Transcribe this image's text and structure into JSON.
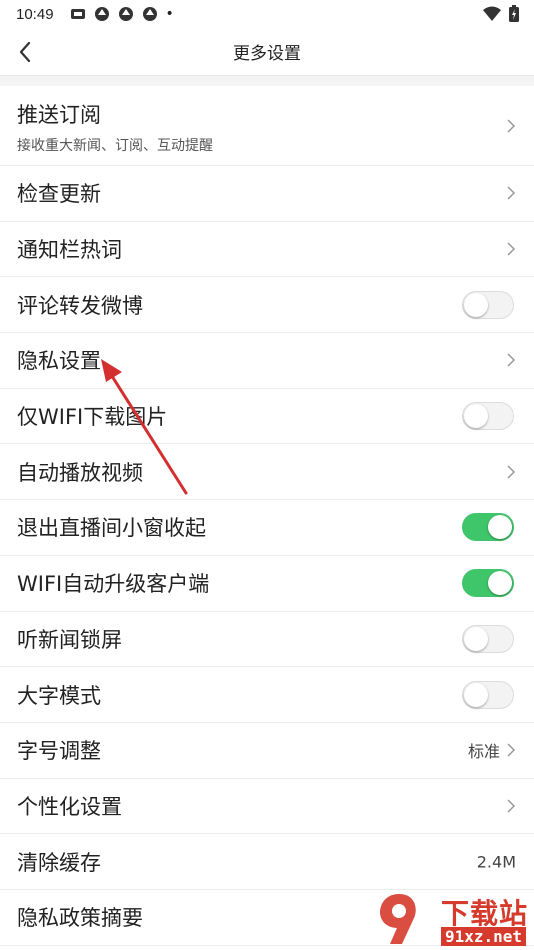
{
  "statusbar": {
    "time": "10:49",
    "dot": "•"
  },
  "navbar": {
    "title": "更多设置"
  },
  "settings": [
    {
      "label": "推送订阅",
      "sub": "接收重大新闻、订阅、互动提醒",
      "control": "chevron"
    },
    {
      "label": "检查更新",
      "control": "chevron"
    },
    {
      "label": "通知栏热词",
      "control": "chevron"
    },
    {
      "label": "评论转发微博",
      "control": "toggle",
      "on": false
    },
    {
      "label": "隐私设置",
      "control": "chevron"
    },
    {
      "label": "仅WIFI下载图片",
      "control": "toggle",
      "on": false
    },
    {
      "label": "自动播放视频",
      "control": "chevron"
    },
    {
      "label": "退出直播间小窗收起",
      "control": "toggle",
      "on": true
    },
    {
      "label": "WIFI自动升级客户端",
      "control": "toggle",
      "on": true
    },
    {
      "label": "听新闻锁屏",
      "control": "toggle",
      "on": false
    },
    {
      "label": "大字模式",
      "control": "toggle",
      "on": false
    },
    {
      "label": "字号调整",
      "control": "value-chevron",
      "value": "标准"
    },
    {
      "label": "个性化设置",
      "control": "chevron"
    },
    {
      "label": "清除缓存",
      "control": "value",
      "value": "2.4M"
    },
    {
      "label": "隐私政策摘要",
      "control": "none"
    }
  ],
  "watermark": {
    "text": "下载站",
    "sub": "91xz.net",
    "logo": "9"
  },
  "colors": {
    "toggle_on": "#3fc56a",
    "annotation_arrow": "#d32f2f"
  }
}
